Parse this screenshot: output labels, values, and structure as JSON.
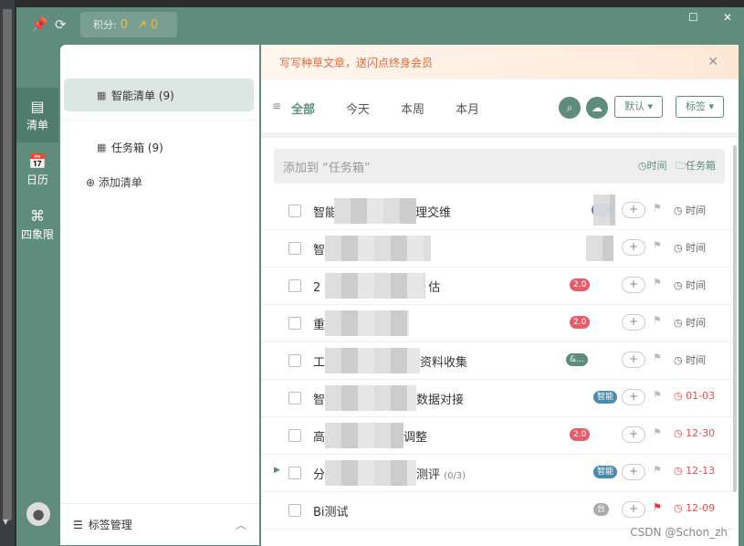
{
  "topbar": {
    "pin_icon": "pin-icon",
    "sync_icon": "sync-icon",
    "points_label": "积分:",
    "points_value": "0",
    "trend_value": "0",
    "maximize_icon": "maximize-icon",
    "close_icon": "close-icon"
  },
  "nav": {
    "items": [
      {
        "label": "清单",
        "icon": "list-icon"
      },
      {
        "label": "日历",
        "icon": "calendar-icon"
      },
      {
        "label": "四象限",
        "icon": "quadrant-icon"
      }
    ]
  },
  "sidebar": {
    "lists": [
      {
        "label": "智能清单 (9)"
      },
      {
        "label": "任务箱 (9)"
      }
    ],
    "add_list": "添加清单",
    "tag_manage": "标签管理"
  },
  "banner": {
    "text": "写写种草文章，送闪点终身会员"
  },
  "tabs": [
    "全部",
    "今天",
    "本周",
    "本月"
  ],
  "toolbar": {
    "default_label": "默认",
    "tag_label": "标签"
  },
  "add_task": {
    "placeholder": "添加到 “任务箱”",
    "time_label": "时间",
    "box_label": "任务箱"
  },
  "tasks": [
    {
      "title": "智能",
      "title_tail": "理交维",
      "date": "时间",
      "date_red": false,
      "tag_color": "#4a8bad"
    },
    {
      "title": "智",
      "title_tail": "",
      "date": "时间",
      "date_red": false,
      "tag_color": "#4a8bad"
    },
    {
      "title": "2",
      "title_tail": "估",
      "date": "时间",
      "date_red": false,
      "tag_color": "#e35d6a",
      "tag_text": "2.0"
    },
    {
      "title": "重",
      "title_tail": "",
      "date": "时间",
      "date_red": false,
      "tag_color": "#e35d6a",
      "tag_text": "2.0"
    },
    {
      "title": "工",
      "title_tail": "资料收集",
      "date": "时间",
      "date_red": false,
      "tag_color": "#5f8c7c",
      "tag_text": "&..."
    },
    {
      "title": "智",
      "title_tail": "数据对接",
      "date": "01-03",
      "date_red": true,
      "tag_color": "#4a8bad",
      "tag_text": "智能"
    },
    {
      "title": "高",
      "title_tail": "调整",
      "date": "12-30",
      "date_red": true,
      "tag_color": "#e35d6a",
      "tag_text": "2.0"
    },
    {
      "title": "分",
      "title_tail": "测评",
      "progress": "(0/3)",
      "date": "12-13",
      "date_red": true,
      "tag_color": "#4a8bad",
      "tag_text": "智能"
    },
    {
      "title": "Bi测试",
      "title_tail": "",
      "date": "12-09",
      "date_red": true,
      "tag_color": "#aaaaaa",
      "tag_text": "台",
      "flag_red": true
    }
  ],
  "watermark": "CSDN @Schon_zh"
}
